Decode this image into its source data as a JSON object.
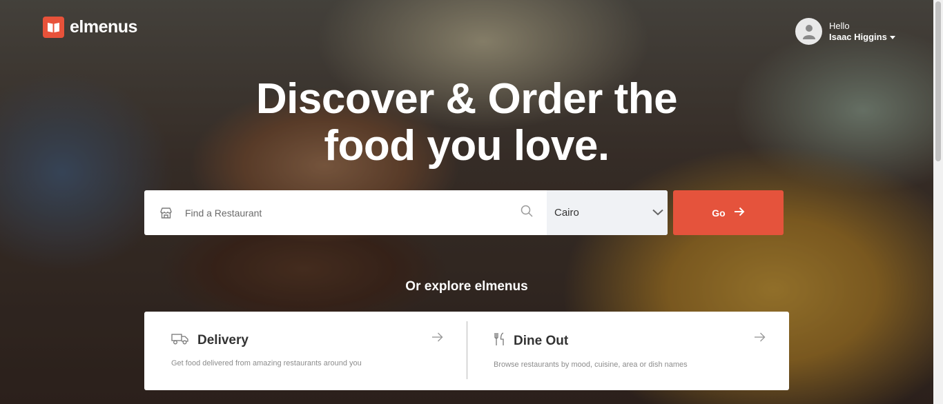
{
  "brand": {
    "name": "elmenus",
    "accent": "#e5533c"
  },
  "user": {
    "greeting": "Hello",
    "name": "Isaac Higgins"
  },
  "hero": {
    "line1": "Discover & Order the",
    "line2": "food you love."
  },
  "search": {
    "placeholder": "Find a Restaurant",
    "city": "Cairo",
    "go_label": "Go"
  },
  "explore": {
    "heading": "Or explore elmenus",
    "cards": [
      {
        "icon": "delivery-truck-icon",
        "title": "Delivery",
        "description": "Get food delivered from amazing restaurants around you"
      },
      {
        "icon": "fork-knife-icon",
        "title": "Dine Out",
        "description": "Browse restaurants by mood, cuisine, area or dish names"
      }
    ]
  }
}
